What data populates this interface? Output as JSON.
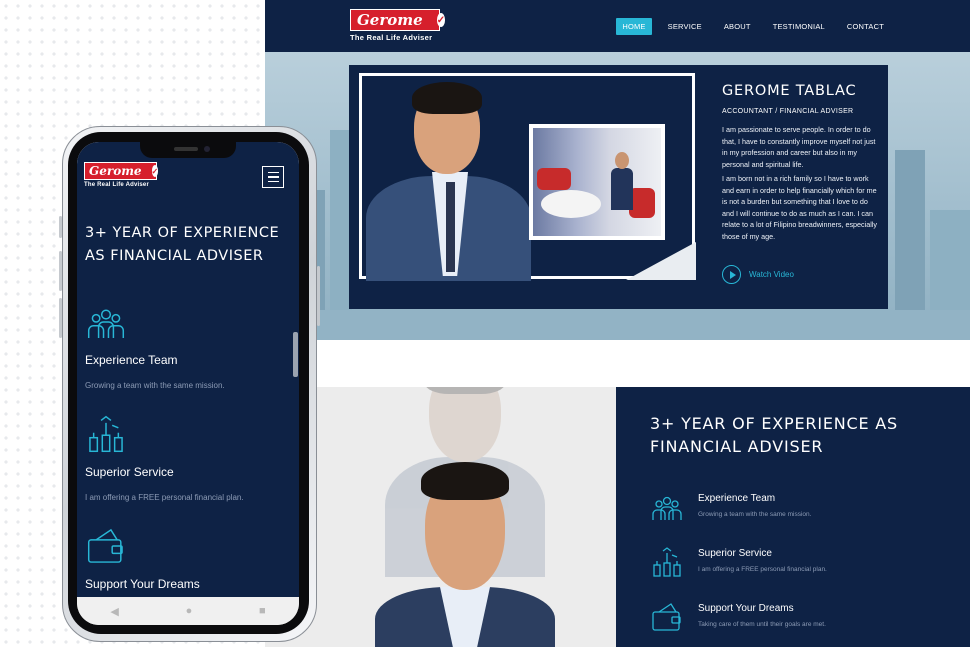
{
  "brand": {
    "name": "Gerome",
    "tagline": "The Real Life Adviser",
    "colors": {
      "navy": "#0e2245",
      "accent": "#28b7d6",
      "logo_red": "#d61f2c"
    }
  },
  "nav": {
    "items": [
      {
        "label": "HOME",
        "active": true
      },
      {
        "label": "SERVICE",
        "active": false
      },
      {
        "label": "ABOUT",
        "active": false
      },
      {
        "label": "TESTIMONIAL",
        "active": false
      },
      {
        "label": "CONTACT",
        "active": false
      }
    ]
  },
  "profile": {
    "name": "GEROME TABLAC",
    "role": "ACCOUNTANT / FINANCIAL ADVISER",
    "para1": "I am passionate to serve people. In order to do that, I have to constantly improve myself not just in my profession and career but also in my personal and spiritual life.",
    "para2": "I am born not in a rich family so I have to work and earn in order to help financially which for me is not a burden but something that I love to do and I will continue to do as much as I can. I can relate to a lot of Filipino breadwinners, especially those of my age.",
    "watch_label": "Watch Video"
  },
  "experience": {
    "heading": "3+ YEAR OF EXPERIENCE AS FINANCIAL ADVISER",
    "features": [
      {
        "title": "Experience Team",
        "desc": "Growing a team with the same mission.",
        "icon": "team-icon"
      },
      {
        "title": "Superior Service",
        "desc": "I am offering a FREE personal financial plan.",
        "icon": "hands-icon"
      },
      {
        "title": "Support Your Dreams",
        "desc": "Taking care of them until their goals are met.",
        "icon": "wallet-icon"
      }
    ]
  },
  "mobile_nav": {
    "back": "◀",
    "home": "●",
    "recent": "■"
  }
}
